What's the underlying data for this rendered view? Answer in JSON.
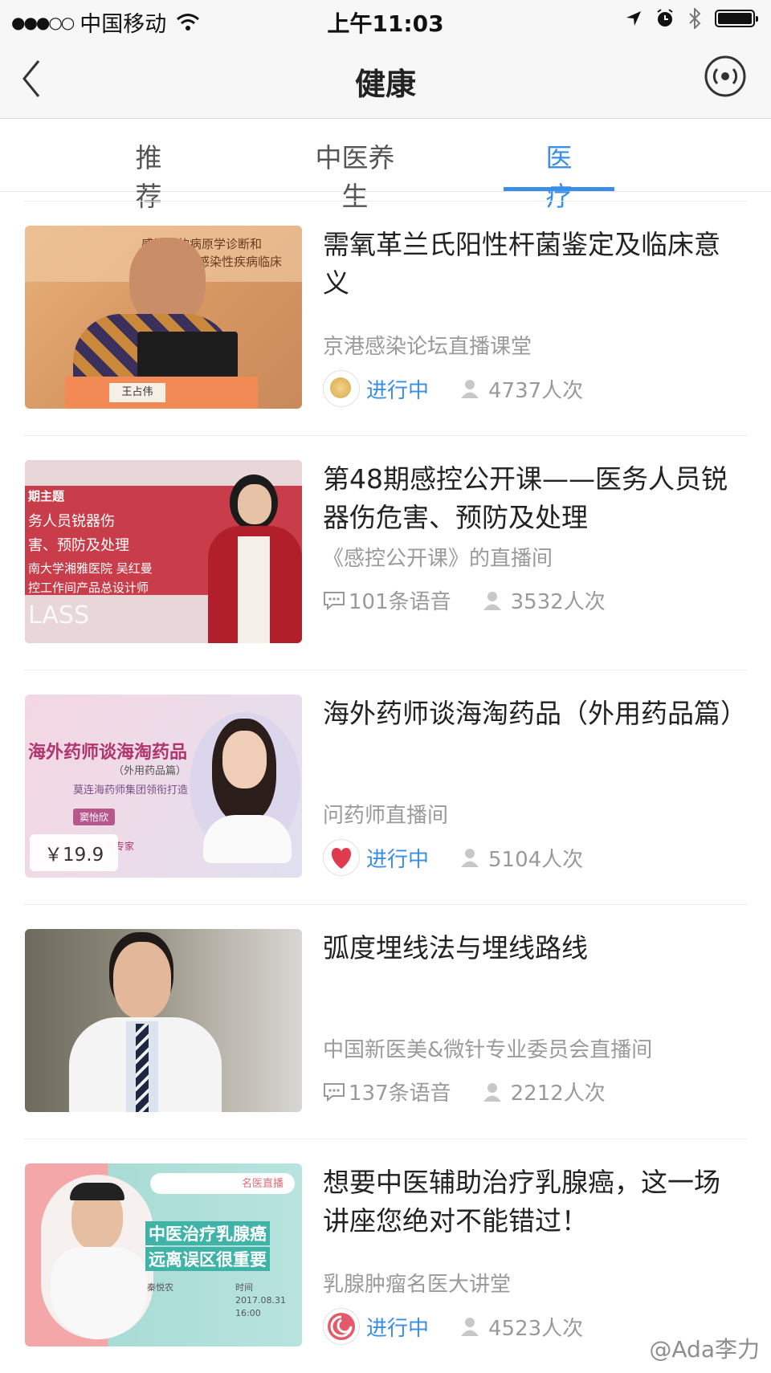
{
  "status_bar": {
    "signal_dots": "●●●○○",
    "carrier": "中国移动",
    "time": "上午11:03",
    "icons": [
      "wifi-icon",
      "location-arrow-icon",
      "alarm-icon",
      "bluetooth-icon",
      "battery-icon"
    ]
  },
  "nav": {
    "title": "健康",
    "back_icon": "chevron-left-icon",
    "right_icon": "live-radio-icon"
  },
  "tabs": [
    {
      "label": "推荐",
      "active": false
    },
    {
      "label": "中医养生",
      "active": false
    },
    {
      "label": "医疗",
      "active": true
    }
  ],
  "colors": {
    "accent": "#3a8ee6",
    "text": "#222222",
    "muted": "#9a9a9a"
  },
  "items": [
    {
      "title": "需氧革兰氏阳性杆菌鉴定及临床意义",
      "source": "京港感染论坛直播课堂",
      "status": "进行中",
      "views": "4737人次",
      "thumb_text": [
        "感染病的病原学诊断和",
        "染感染性疾病临床",
        "王占伟"
      ]
    },
    {
      "title": "第48期感控公开课——医务人员锐器伤危害、预防及处理",
      "source": "《感控公开课》的直播间",
      "voice_count": "101条语音",
      "views": "3532人次",
      "thumb_text": [
        "期主题",
        "务人员锐器伤",
        "害、预防及处理",
        "南大学湘雅医院 吴红曼",
        "控工作间产品总设计师",
        "LASS"
      ]
    },
    {
      "title": "海外药师谈海淘药品（外用药品篇）",
      "source": "问药师直播间",
      "status": "进行中",
      "views": "5104人次",
      "price": "￥19.9",
      "thumb_text": [
        "海外药师谈海淘药品",
        "（外用药品篇）",
        "莫连海药师集团领衔打造",
        "窦怡欣",
        "导专家"
      ]
    },
    {
      "title": "弧度埋线法与埋线路线",
      "source": "中国新医美&微针专业委员会直播间",
      "voice_count": "137条语音",
      "views": "2212人次"
    },
    {
      "title": "想要中医辅助治疗乳腺癌，这一场讲座您绝对不能错过！",
      "source": "乳腺肿瘤名医大讲堂",
      "status": "进行中",
      "views": "4523人次",
      "thumb_text": [
        "名医直播",
        "中医治疗乳腺癌",
        "远离误区很重要",
        "秦悦农",
        "时间",
        "2017.08.31",
        "16:00"
      ]
    }
  ],
  "watermark": "@Ada李力"
}
